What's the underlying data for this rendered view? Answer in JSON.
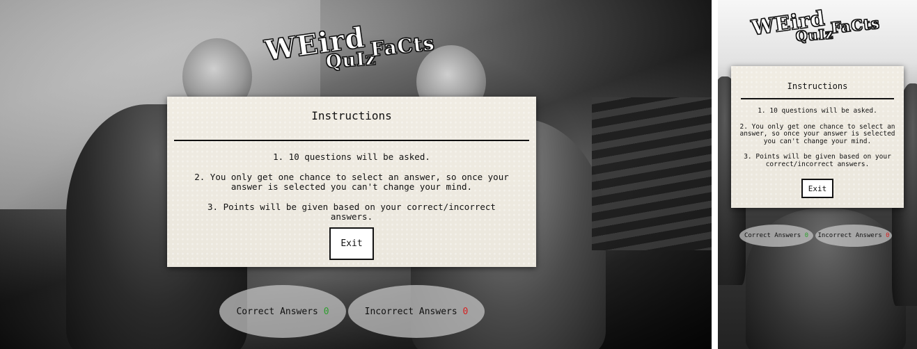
{
  "logo": {
    "word1": "WEird",
    "word2": "QuIz",
    "word3": "FaCts"
  },
  "modal": {
    "title": "Instructions",
    "line1": "1. 10 questions will be asked.",
    "line2": "2. You only get one chance to select an answer, so once your answer is selected you can't change your mind.",
    "line3": "3. Points will be given based on your correct/incorrect answers.",
    "exit_label": "Exit"
  },
  "scores": {
    "correct_label": "Correct Answers",
    "correct_value": "0",
    "incorrect_label": "Incorrect Answers",
    "incorrect_value": "0"
  },
  "colors": {
    "correct": "#2e9e2e",
    "incorrect": "#d62020",
    "card": "#ece8de"
  }
}
